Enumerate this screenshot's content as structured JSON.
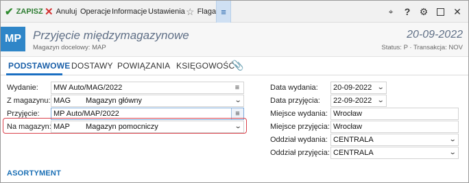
{
  "toolbar": {
    "save_label": "ZAPISZ",
    "cancel_label": "Anuluj",
    "operations_label": "Operacje",
    "info_label": "Informacje",
    "settings_label": "Ustawienia",
    "flag_label": "Flaga"
  },
  "header": {
    "badge": "MP",
    "title": "Przyjęcie międzymagazynowe",
    "subtitle": "Magazyn docelowy:  MAP",
    "date": "20-09-2022",
    "status_line": "Status: P  ·  Transakcja: NOV"
  },
  "tabs": [
    {
      "label": "PODSTAWOWE",
      "active": true
    },
    {
      "label": "DOSTAWY",
      "active": false
    },
    {
      "label": "POWIĄZANIA",
      "active": false
    },
    {
      "label": "KSIĘGOWOŚĆ",
      "active": false
    }
  ],
  "form_left": {
    "wydanie": {
      "label": "Wydanie:",
      "value": "MW Auto/MAG/2022"
    },
    "z_magazynu": {
      "label": "Z magazynu:",
      "code": "MAG",
      "name": "Magazyn główny"
    },
    "przyjecie": {
      "label": "Przyjęcie:",
      "value": "MP Auto/MAP/2022"
    },
    "na_magazyn": {
      "label": "Na magazyn:",
      "code": "MAP",
      "name": "Magazyn pomocniczy"
    }
  },
  "form_right": {
    "data_wydania": {
      "label": "Data wydania:",
      "value": "20-09-2022"
    },
    "data_przyjecia": {
      "label": "Data przyjęcia:",
      "value": "22-09-2022"
    },
    "miejsce_wydania": {
      "label": "Miejsce wydania:",
      "value": "Wrocław"
    },
    "miejsce_przyjecia": {
      "label": "Miejsce przyjęcia:",
      "value": "Wrocław"
    },
    "oddzial_wydania": {
      "label": "Oddział wydania:",
      "value": "CENTRALA"
    },
    "oddzial_przyjecia": {
      "label": "Oddział przyjęcia:",
      "value": "CENTRALA"
    }
  },
  "sections": {
    "assortment_title": "ASORTYMENT"
  },
  "colors": {
    "accent": "#1a6fc2",
    "badge_bg": "#2f86c8",
    "save_green": "#2e8b2e",
    "cancel_red": "#d32f2f",
    "highlight_red": "#d9404a"
  },
  "icons": {
    "save": "check-icon",
    "cancel": "x-icon",
    "flag": "star-icon",
    "menu": "hamburger-icon",
    "add_property": "tag-plus-icon",
    "help": "question-icon",
    "settings": "gear-icon",
    "maximize": "maximize-icon",
    "close": "close-icon",
    "attachment": "paperclip-icon"
  }
}
